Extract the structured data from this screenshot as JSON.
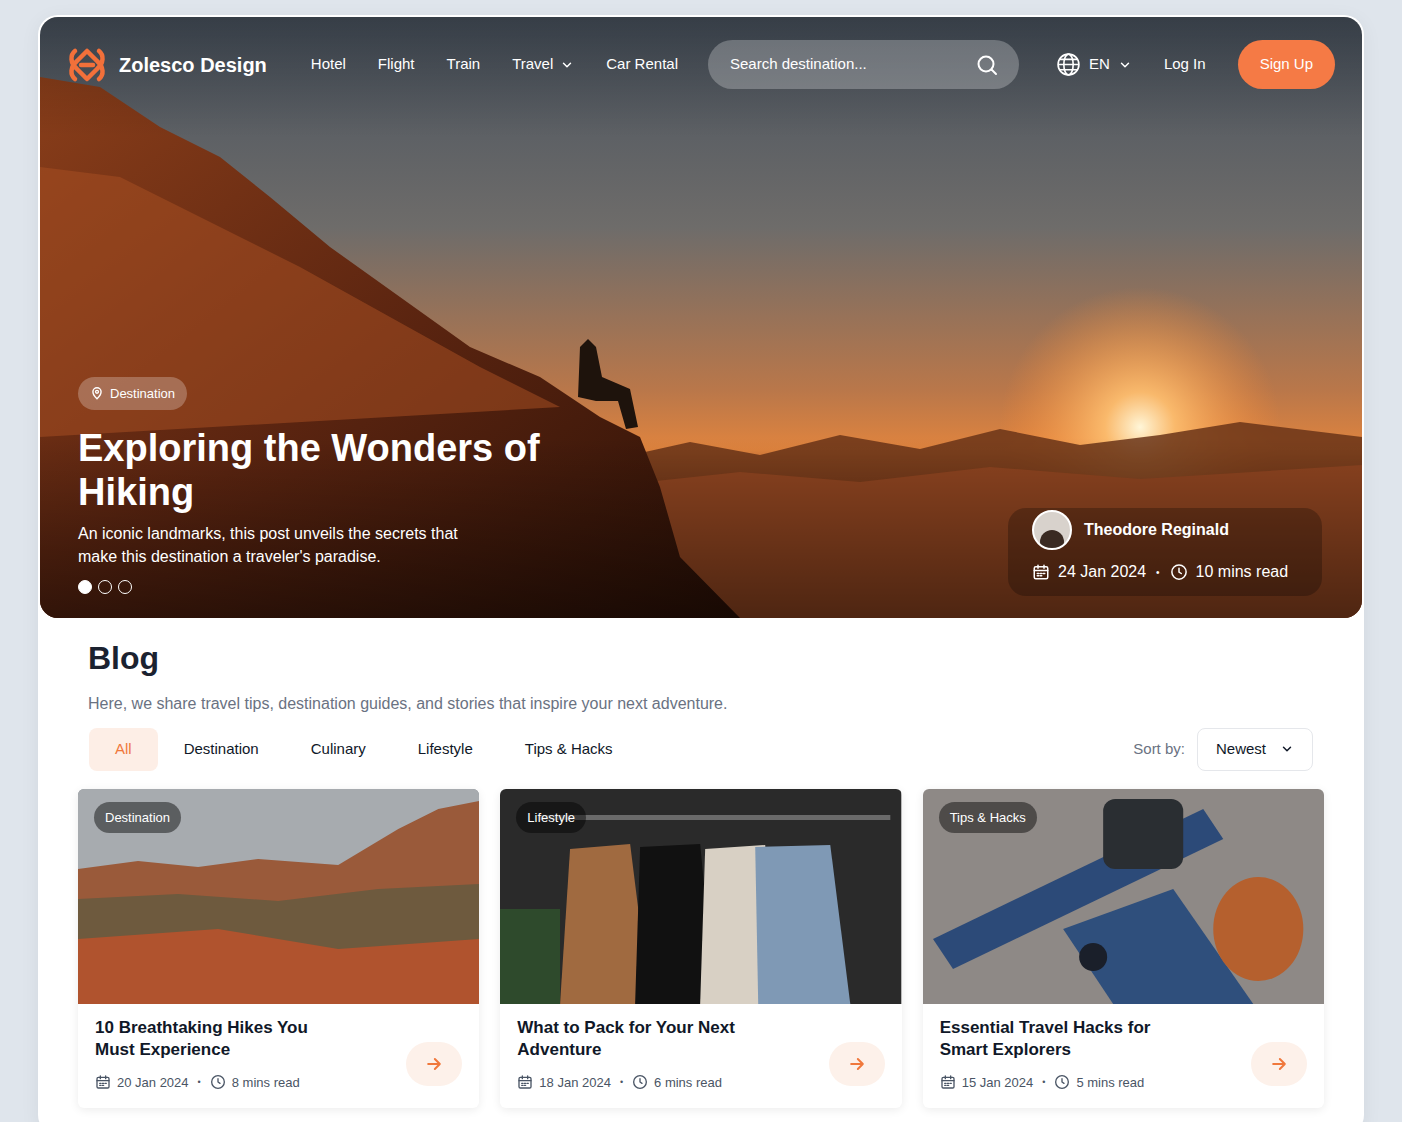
{
  "brand": {
    "name": "Zolesco Design"
  },
  "nav": {
    "items": [
      {
        "label": "Hotel",
        "kind": "link"
      },
      {
        "label": "Flight",
        "kind": "link"
      },
      {
        "label": "Train",
        "kind": "link"
      },
      {
        "label": "Travel",
        "kind": "dropdown"
      },
      {
        "label": "Car Rental",
        "kind": "link"
      }
    ]
  },
  "search": {
    "placeholder": "Search destination..."
  },
  "language": {
    "label": "EN"
  },
  "auth": {
    "login": "Log In",
    "signup": "Sign Up"
  },
  "meta_separator": "•",
  "hero": {
    "tag": "Destination",
    "title": "Exploring the Wonders of Hiking",
    "description": "An iconic landmarks, this post unveils the secrets that make this destination a traveler's paradise.",
    "slides": [
      {
        "selected": true
      },
      {
        "selected": false
      },
      {
        "selected": false
      }
    ],
    "author": {
      "name": "Theodore Reginald",
      "date": "24 Jan 2024",
      "read_time": "10 mins read"
    }
  },
  "blog": {
    "title": "Blog",
    "subtitle": "Here, we share travel tips, destination guides, and stories that inspire your next adventure.",
    "filters": [
      {
        "label": "All",
        "selected": true
      },
      {
        "label": "Destination",
        "selected": false
      },
      {
        "label": "Culinary",
        "selected": false
      },
      {
        "label": "Lifestyle",
        "selected": false
      },
      {
        "label": "Tips & Hacks",
        "selected": false
      }
    ],
    "sort": {
      "label": "Sort by:",
      "value": "Newest"
    }
  },
  "posts": [
    {
      "tag": "Destination",
      "title": "10 Breathtaking Hikes You Must Experience",
      "date": "20 Jan 2024",
      "read_time": "8 mins read"
    },
    {
      "tag": "Lifestyle",
      "title": "What to Pack for Your Next Adventure",
      "date": "18 Jan 2024",
      "read_time": "6 mins read"
    },
    {
      "tag": "Tips & Hacks",
      "title": "Essential Travel Hacks for Smart Explorers",
      "date": "15 Jan 2024",
      "read_time": "5 mins read"
    }
  ]
}
